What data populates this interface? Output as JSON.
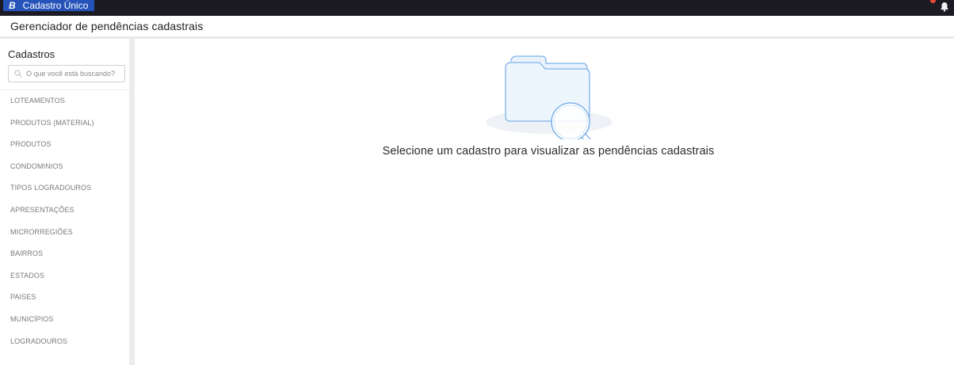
{
  "topbar": {
    "logo_letter": "B",
    "app_title": "Cadastro Único"
  },
  "header": {
    "title": "Gerenciador de pendências cadastrais"
  },
  "sidebar": {
    "title": "Cadastros",
    "search_placeholder": "O que você está buscando?",
    "items": [
      {
        "label": "LOTEAMENTOS"
      },
      {
        "label": "PRODUTOS (MATERIAL)"
      },
      {
        "label": "PRODUTOS"
      },
      {
        "label": "CONDOMINIOS"
      },
      {
        "label": "TIPOS LOGRADOUROS"
      },
      {
        "label": "APRESENTAÇÕES"
      },
      {
        "label": "MICRORREGIÕES"
      },
      {
        "label": "BAIRROS"
      },
      {
        "label": "ESTADOS"
      },
      {
        "label": "PAISES"
      },
      {
        "label": "MUNICÍPIOS"
      },
      {
        "label": "LOGRADOUROS"
      }
    ]
  },
  "main": {
    "empty_message": "Selecione um cadastro para visualizar as pendências cadastrais",
    "illustration": "folder-search-icon"
  },
  "colors": {
    "topbar_bg": "#1c1b24",
    "brand_bg": "#2553b9",
    "badge": "#e84a3a",
    "illustration_stroke": "#7fb2e8"
  },
  "icons": [
    "bell-icon",
    "search-icon",
    "folder-search-icon"
  ]
}
